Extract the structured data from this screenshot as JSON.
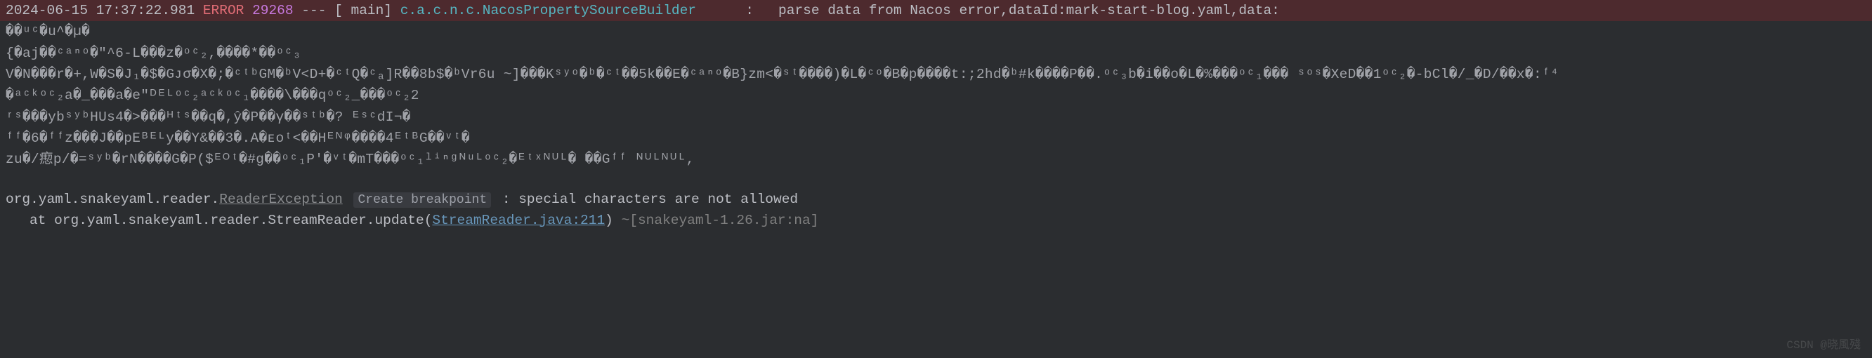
{
  "error_header": {
    "timestamp": "2024-06-15 17:37:22.981",
    "level": "ERROR",
    "pid": "29268",
    "separator": "---",
    "thread": "[                main]",
    "logger": "c.a.c.n.c.NacosPropertySourceBuilder",
    "colon": ":",
    "message": "parse data from Nacos error,dataId:mark-start-blog.yaml,data:"
  },
  "garbage": {
    "l1": "��ᵘᶜ�u^�µ�",
    "l2": "{�aj��ᶜᵃⁿᵒ�\"^6-L���z�ᵒᶜ₂,����*��ᵒᶜ₃",
    "l3": "V�N���r�+,W�S�J₁�$�Gᴊσ�X�;�ᶜᵗᵇGM�ᵇV<D+�ᶜᵗQ�ᶜₐ]R��8b$�ᵇVr6u ~]���Kˢʸᵒ�ᵇ�ᶜᵗ��5k��E�ᶜᵃⁿᵒ�B}zm<�ˢᵗ����)�L�ᶜᵒ�B�p����t:;2hd�ᵇ#k����P��.ᵒᶜ₃b�i��o�L�%���ᵒᶜ₁��� ˢᵒˢ�XeD��1ᵒᶜ₂�-bCl�/_�D/��x�:ᶠ⁴",
    "l4": "�ᵃᶜᵏᵒᶜ₂a�_���a�e\"ᴰᴱᴸᵒᶜ₂ᵃᶜᵏᵒᶜ₁����\\���qᵒᶜ₂_���ᵒᶜ₂2",
    "l5": "ʳˢ���ybˢʸᵇHUs4�>���ᴴᵗˢ��q�,ŷ�P��γ��ˢᵗᵇ�?     ᴱˢᶜdI¬�",
    "l6": "ᶠᶠ�6�ᶠᶠz���J��pEᴮᴱᴸy��Y&��3�.A�ᴇᴏᵗ<��Hᴱᴺᵠ����4ᴱᵗᴮG��ᵛᵗ�",
    "l7": "zu�/瘛p/�=ˢʸᵇ�rN����G�P($ᴱᴼᵗ�#g��ᵒᶜ₁P'�ᵛᵗ�mT���ᵒᶜ₁ˡⁱⁿᵍᴺᵘᴸᵒᶜ₂�ᴱᵗˣᴺᵁᴸ�   ��Gᶠᶠ ᴺᵁᴸᴺᵁᴸ,"
  },
  "exception": {
    "package_prefix": "org.yaml.snakeyaml.reader.",
    "exception_name": "ReaderException",
    "create_breakpoint_label": "Create breakpoint",
    "message": ": special characters are not allowed"
  },
  "stack": {
    "at_label": "at",
    "method": "org.yaml.snakeyaml.reader.StreamReader.update(",
    "file_link": "StreamReader.java:211",
    "closing": ")",
    "jar_suffix": "~[snakeyaml-1.26.jar:na]"
  },
  "watermark": "CSDN @晓風殘"
}
